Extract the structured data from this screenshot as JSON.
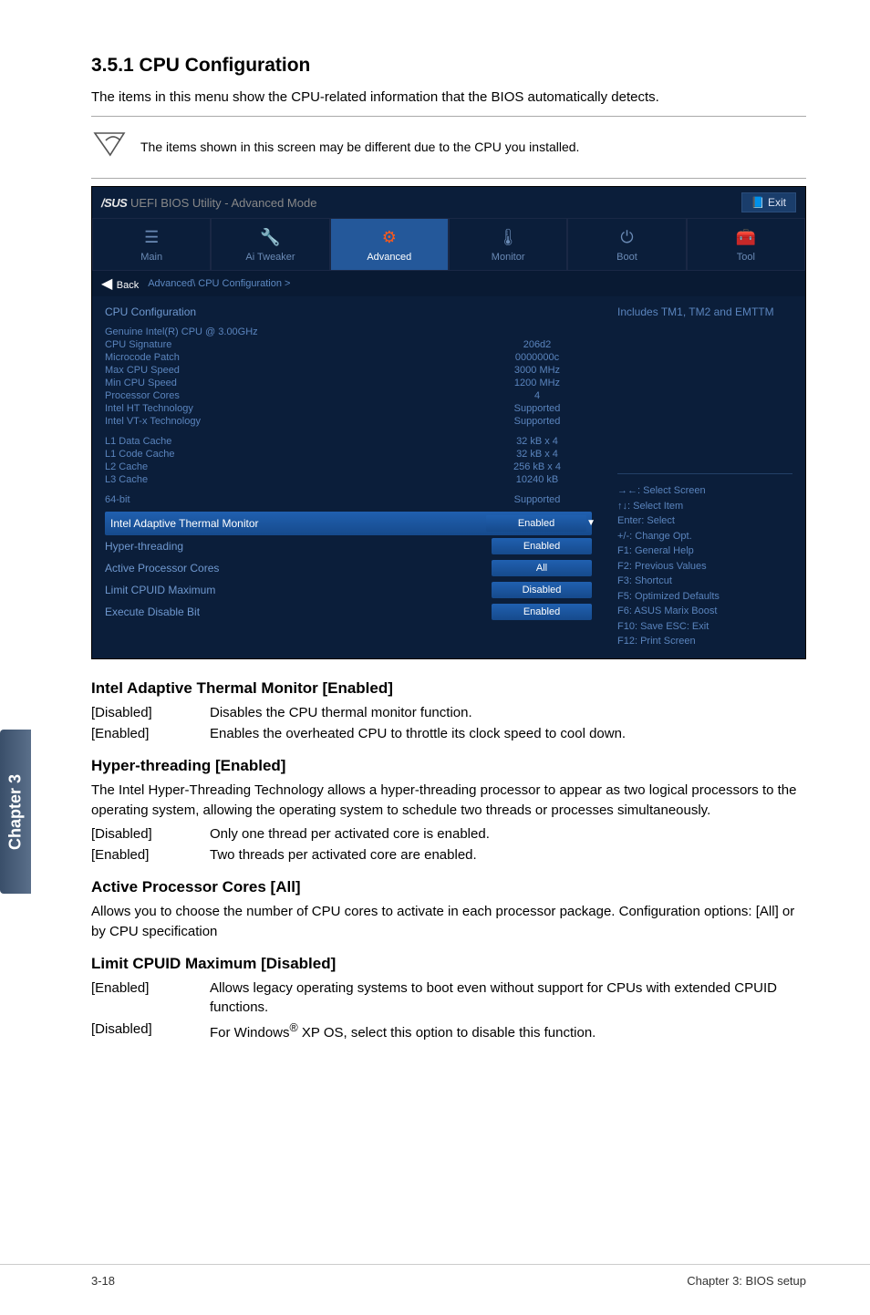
{
  "section_number_title": "3.5.1      CPU Configuration",
  "section_intro": "The items in this menu show the CPU-related information that the BIOS automatically detects.",
  "note_text": "The items shown in this screen may be different due to the CPU you installed.",
  "bios": {
    "title_brand": "/SUS",
    "title_text": "UEFI BIOS Utility - Advanced Mode",
    "exit_label": "Exit",
    "tabs": {
      "main": "Main",
      "ai": "Ai Tweaker",
      "advanced": "Advanced",
      "monitor": "Monitor",
      "boot": "Boot",
      "tool": "Tool"
    },
    "breadcrumb_back": "Back",
    "breadcrumb": "Advanced\\ CPU Configuration >",
    "left_heading": "CPU Configuration",
    "info": [
      {
        "k": "Genuine Intel(R) CPU @ 3.00GHz",
        "v": ""
      },
      {
        "k": "CPU Signature",
        "v": "206d2"
      },
      {
        "k": "Microcode Patch",
        "v": "0000000c"
      },
      {
        "k": "Max CPU Speed",
        "v": "3000 MHz"
      },
      {
        "k": "Min CPU Speed",
        "v": "1200 MHz"
      },
      {
        "k": "Processor Cores",
        "v": "4"
      },
      {
        "k": "Intel HT Technology",
        "v": "Supported"
      },
      {
        "k": "Intel VT-x Technology",
        "v": "Supported"
      }
    ],
    "caches": [
      {
        "k": "L1 Data Cache",
        "v": "32 kB x 4"
      },
      {
        "k": "L1 Code Cache",
        "v": "32 kB x 4"
      },
      {
        "k": "L2 Cache",
        "v": "256 kB x 4"
      },
      {
        "k": "L3 Cache",
        "v": "10240 kB"
      }
    ],
    "sixtyfour": {
      "k": "64-bit",
      "v": "Supported"
    },
    "options": [
      {
        "k": "Intel Adaptive Thermal Monitor",
        "v": "Enabled",
        "selected": true
      },
      {
        "k": "Hyper-threading",
        "v": "Enabled"
      },
      {
        "k": "Active Processor Cores",
        "v": "All"
      },
      {
        "k": "Limit CPUID Maximum",
        "v": "Disabled"
      },
      {
        "k": "Execute Disable Bit",
        "v": "Enabled"
      }
    ],
    "right_desc": "Includes TM1, TM2 and EMTTM",
    "help": [
      "→←: Select Screen",
      "↑↓: Select Item",
      "Enter: Select",
      "+/-: Change Opt.",
      "F1: General Help",
      "F2: Previous Values",
      "F3: Shortcut",
      "F5: Optimized Defaults",
      "F6: ASUS Marix Boost",
      "F10: Save ESC: Exit",
      "F12: Print Screen"
    ]
  },
  "s1": {
    "h": "Intel Adaptive Thermal Monitor [Enabled]",
    "r1k": "[Disabled]",
    "r1v": "Disables the CPU thermal monitor function.",
    "r2k": "[Enabled]",
    "r2v": "Enables the overheated CPU to throttle its clock speed to cool down."
  },
  "s2": {
    "h": "Hyper-threading [Enabled]",
    "p": "The Intel Hyper-Threading Technology allows a hyper-threading processor to appear as two logical processors to the operating system, allowing the operating system to schedule two threads or processes simultaneously.",
    "r1k": "[Disabled]",
    "r1v": "Only one thread per activated core is enabled.",
    "r2k": "[Enabled]",
    "r2v": "Two threads per activated core are enabled."
  },
  "s3": {
    "h": "Active Processor Cores [All]",
    "p": "Allows you to choose the number of CPU cores to activate in each processor package. Configuration options: [All] or by CPU specification"
  },
  "s4": {
    "h": "Limit CPUID Maximum [Disabled]",
    "r1k": "[Enabled]",
    "r1v": "Allows legacy operating systems to boot even without support for CPUs with extended CPUID functions.",
    "r2k": "[Disabled]",
    "r2v_pre": "For Windows",
    "r2v_sup": "®",
    "r2v_post": " XP OS, select this option to disable this function."
  },
  "side_tab": "Chapter 3",
  "footer_left": "3-18",
  "footer_right": "Chapter 3: BIOS setup"
}
